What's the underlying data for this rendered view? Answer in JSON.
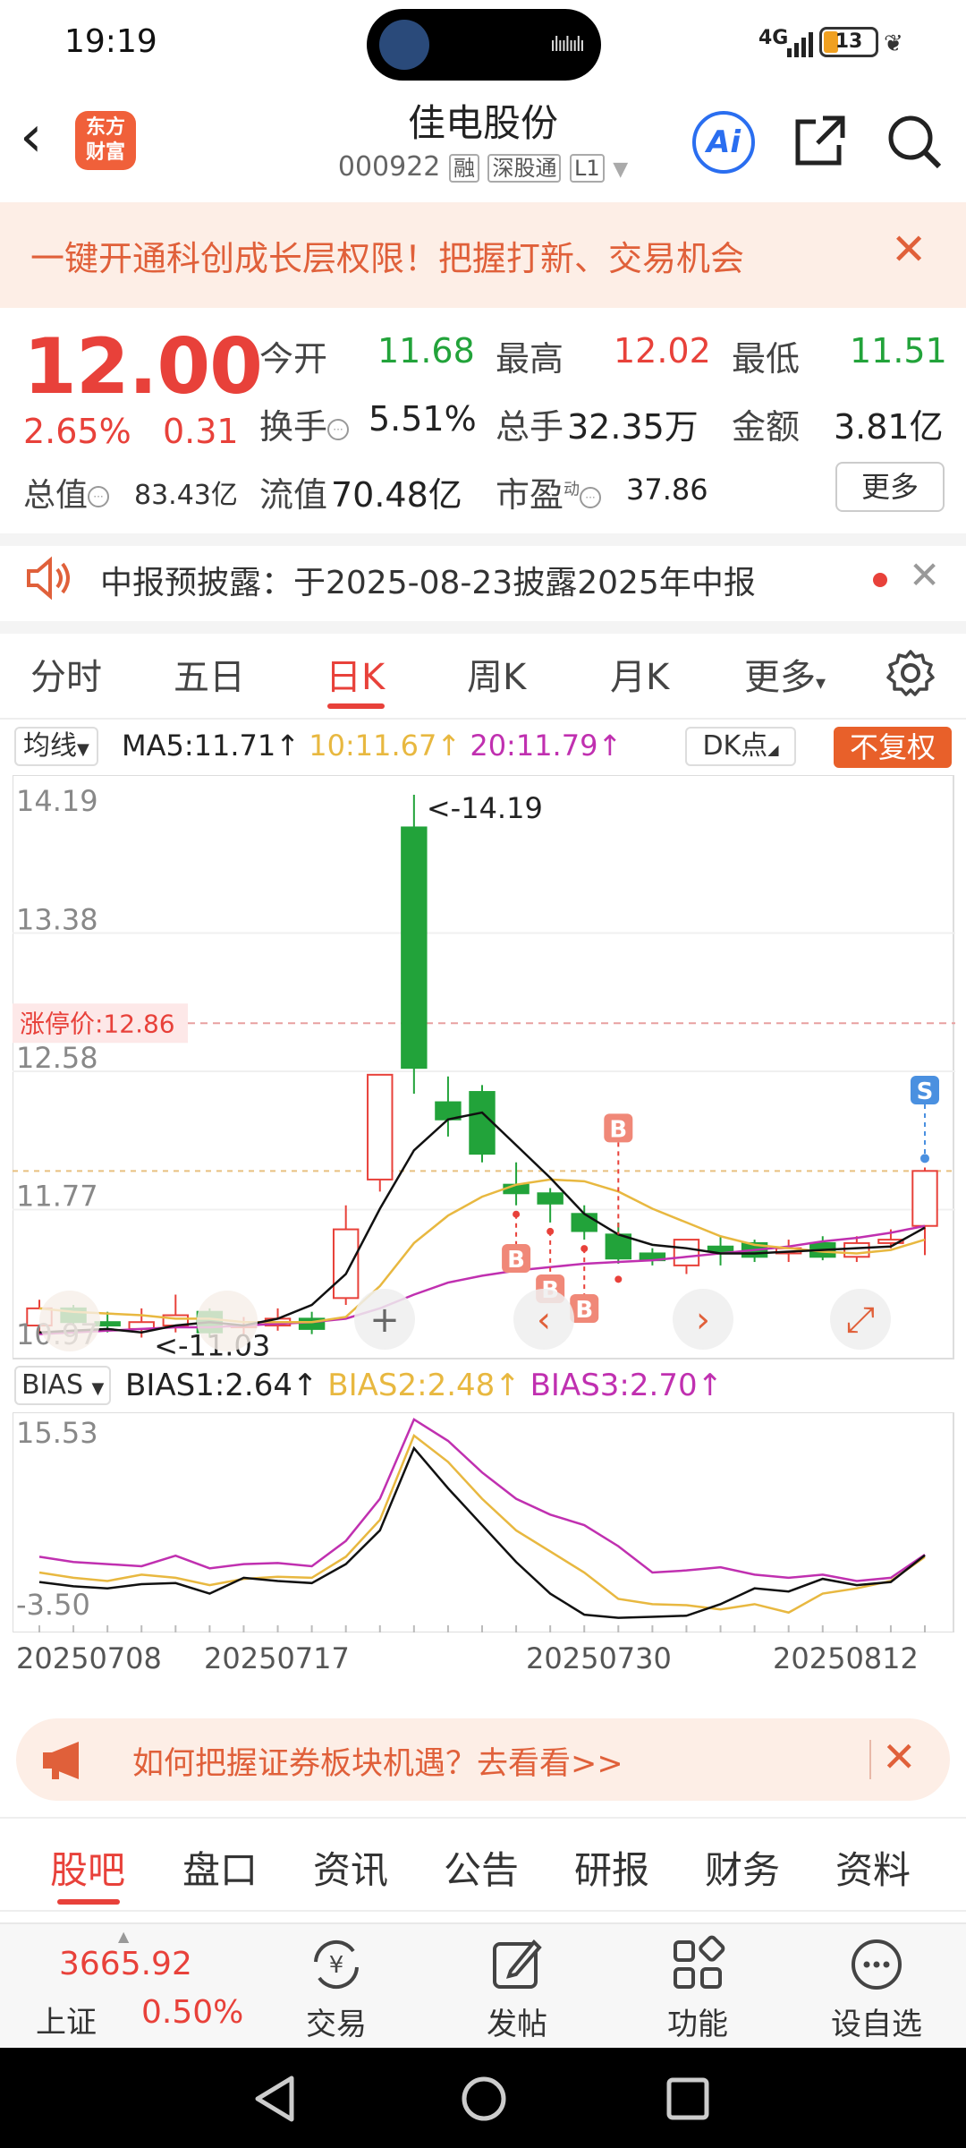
{
  "status_bar": {
    "time": "19:19",
    "network": "4G",
    "battery": "13"
  },
  "header": {
    "logo_line1": "东方",
    "logo_line2": "财富",
    "stock_name": "佳电股份",
    "stock_code": "000922",
    "tag_margin": "融",
    "tag_connect": "深股通",
    "tag_level": "L1",
    "ai_label": "Ai"
  },
  "banner": {
    "text": "一键开通科创成长层权限！把握打新、交易机会"
  },
  "quote": {
    "price": "12.00",
    "change_pct": "2.65%",
    "change_abs": "0.31",
    "open_label": "今开",
    "open": "11.68",
    "high_label": "最高",
    "high": "12.02",
    "low_label": "最低",
    "low": "11.51",
    "turnover_label": "换手",
    "turnover": "5.51%",
    "volume_label": "总手",
    "volume": "32.35万",
    "amount_label": "金额",
    "amount": "3.81亿",
    "mcap_label": "总值",
    "mcap": "83.43亿",
    "float_label": "流值",
    "float": "70.48亿",
    "pe_label": "市盈",
    "pe_sup": "动",
    "pe": "37.86",
    "more_label": "更多"
  },
  "notice": {
    "text": "中报预披露：于2025-08-23披露2025年中报"
  },
  "period_tabs": [
    "分时",
    "五日",
    "日K",
    "周K",
    "月K",
    "更多"
  ],
  "period_active": "日K",
  "ma_row": {
    "select": "均线",
    "ma5": "MA5:11.71↑",
    "ma10": "10:11.67↑",
    "ma20": "20:11.79↑",
    "dk": "DK点",
    "adjust": "不复权"
  },
  "colors": {
    "up": "#e8413a",
    "down": "#22a33a",
    "ma5": "#111111",
    "ma10": "#e8b840",
    "ma20": "#c030b0"
  },
  "chart_data": [
    {
      "type": "candlestick",
      "y_labels": [
        "14.19",
        "13.38",
        "12.58",
        "11.77",
        "10.97"
      ],
      "ylim": [
        10.97,
        14.19
      ],
      "limit_up_label": "涨停价:12.86",
      "limit_up": 12.86,
      "max_label": "<-14.19",
      "min_label": "<-11.03",
      "candles": [
        {
          "o": 11.1,
          "c": 11.2,
          "h": 11.25,
          "l": 11.05
        },
        {
          "o": 11.2,
          "c": 11.12,
          "h": 11.22,
          "l": 11.1
        },
        {
          "o": 11.12,
          "c": 11.1,
          "h": 11.18,
          "l": 11.06
        },
        {
          "o": 11.08,
          "c": 11.12,
          "h": 11.2,
          "l": 11.03
        },
        {
          "o": 11.1,
          "c": 11.16,
          "h": 11.28,
          "l": 11.06
        },
        {
          "o": 11.18,
          "c": 11.06,
          "h": 11.2,
          "l": 11.03
        },
        {
          "o": 11.1,
          "c": 11.1,
          "h": 11.15,
          "l": 11.05
        },
        {
          "o": 11.1,
          "c": 11.14,
          "h": 11.2,
          "l": 11.07
        },
        {
          "o": 11.14,
          "c": 11.08,
          "h": 11.18,
          "l": 11.05
        },
        {
          "o": 11.26,
          "c": 11.66,
          "h": 11.8,
          "l": 11.22
        },
        {
          "o": 11.95,
          "c": 12.56,
          "h": 12.56,
          "l": 11.88
        },
        {
          "o": 14.0,
          "c": 12.6,
          "h": 14.19,
          "l": 12.45
        },
        {
          "o": 12.4,
          "c": 12.3,
          "h": 12.55,
          "l": 12.2
        },
        {
          "o": 12.46,
          "c": 12.1,
          "h": 12.5,
          "l": 12.05
        },
        {
          "o": 11.92,
          "c": 11.87,
          "h": 12.05,
          "l": 11.8
        },
        {
          "o": 11.87,
          "c": 11.81,
          "h": 11.9,
          "l": 11.7
        },
        {
          "o": 11.75,
          "c": 11.65,
          "h": 11.8,
          "l": 11.6
        },
        {
          "o": 11.63,
          "c": 11.49,
          "h": 11.7,
          "l": 11.46
        },
        {
          "o": 11.52,
          "c": 11.48,
          "h": 11.55,
          "l": 11.45
        },
        {
          "o": 11.45,
          "c": 11.6,
          "h": 11.6,
          "l": 11.4
        },
        {
          "o": 11.56,
          "c": 11.53,
          "h": 11.62,
          "l": 11.45
        },
        {
          "o": 11.58,
          "c": 11.5,
          "h": 11.6,
          "l": 11.47
        },
        {
          "o": 11.52,
          "c": 11.55,
          "h": 11.6,
          "l": 11.47
        },
        {
          "o": 11.58,
          "c": 11.5,
          "h": 11.62,
          "l": 11.48
        },
        {
          "o": 11.5,
          "c": 11.58,
          "h": 11.62,
          "l": 11.47
        },
        {
          "o": 11.58,
          "c": 11.6,
          "h": 11.66,
          "l": 11.55
        },
        {
          "o": 11.68,
          "c": 12.0,
          "h": 12.02,
          "l": 11.51
        }
      ],
      "ma5": [
        11.06,
        11.07,
        11.08,
        11.06,
        11.1,
        11.12,
        11.1,
        11.14,
        11.22,
        11.4,
        11.78,
        12.12,
        12.3,
        12.34,
        12.15,
        11.96,
        11.75,
        11.63,
        11.57,
        11.55,
        11.52,
        11.52,
        11.53,
        11.54,
        11.55,
        11.56,
        11.67
      ],
      "ma10": [
        11.2,
        11.18,
        11.17,
        11.16,
        11.14,
        11.14,
        11.12,
        11.12,
        11.12,
        11.15,
        11.33,
        11.58,
        11.74,
        11.85,
        11.92,
        11.95,
        11.94,
        11.88,
        11.78,
        11.7,
        11.62,
        11.57,
        11.55,
        11.53,
        11.52,
        11.54,
        11.6
      ],
      "ma20": [
        11.05,
        11.06,
        11.07,
        11.08,
        11.09,
        11.09,
        11.1,
        11.11,
        11.12,
        11.14,
        11.2,
        11.28,
        11.35,
        11.39,
        11.42,
        11.44,
        11.46,
        11.47,
        11.48,
        11.5,
        11.52,
        11.54,
        11.56,
        11.59,
        11.61,
        11.64,
        11.68
      ],
      "buy_marks": [
        14,
        15,
        16,
        17
      ],
      "sell_marks": [
        26
      ],
      "buy_label": "B",
      "sell_label": "S"
    },
    {
      "type": "line",
      "indicator": "BIAS",
      "select": "BIAS",
      "bias1_label": "BIAS1:2.64↑",
      "bias2_label": "BIAS2:2.48↑",
      "bias3_label": "BIAS3:2.70↑",
      "y_labels": [
        "15.53",
        "-3.50"
      ],
      "ylim": [
        -3.5,
        15.53
      ],
      "x_labels": [
        "20250708",
        "20250717",
        "20250730",
        "20250812"
      ],
      "bias1": [
        0.1,
        -0.3,
        -0.5,
        -0.1,
        0.0,
        -1.0,
        0.5,
        0.2,
        0.0,
        1.8,
        5.0,
        12.8,
        9.0,
        5.5,
        2.0,
        -1.0,
        -3.0,
        -3.3,
        -3.2,
        -3.1,
        -2.0,
        -0.5,
        -0.8,
        0.4,
        -0.2,
        0.1,
        2.64
      ],
      "bias2": [
        1.0,
        0.5,
        0.2,
        0.8,
        0.5,
        -0.2,
        0.4,
        0.6,
        0.5,
        2.5,
        6.0,
        14.0,
        11.5,
        8.0,
        5.0,
        3.0,
        1.0,
        -1.5,
        -2.0,
        -2.1,
        -2.5,
        -2.0,
        -2.8,
        -1.0,
        -0.5,
        0.2,
        2.48
      ],
      "bias3": [
        2.5,
        2.0,
        1.8,
        1.6,
        2.6,
        1.4,
        1.8,
        1.9,
        1.6,
        4.0,
        8.0,
        15.53,
        13.5,
        10.5,
        8.0,
        6.5,
        5.5,
        3.5,
        1.0,
        1.2,
        1.5,
        0.8,
        0.5,
        0.8,
        0.2,
        0.5,
        2.7
      ]
    }
  ],
  "promo": {
    "text": "如何把握证券板块机遇？去看看>>"
  },
  "bottom_tabs": [
    "股吧",
    "盘口",
    "资讯",
    "公告",
    "研报",
    "财务",
    "资料"
  ],
  "bottom_bar": {
    "index_value": "3665.92",
    "index_name": "上证",
    "index_pct": "0.50%",
    "trade": "交易",
    "post": "发帖",
    "func": "功能",
    "watch": "设自选"
  }
}
